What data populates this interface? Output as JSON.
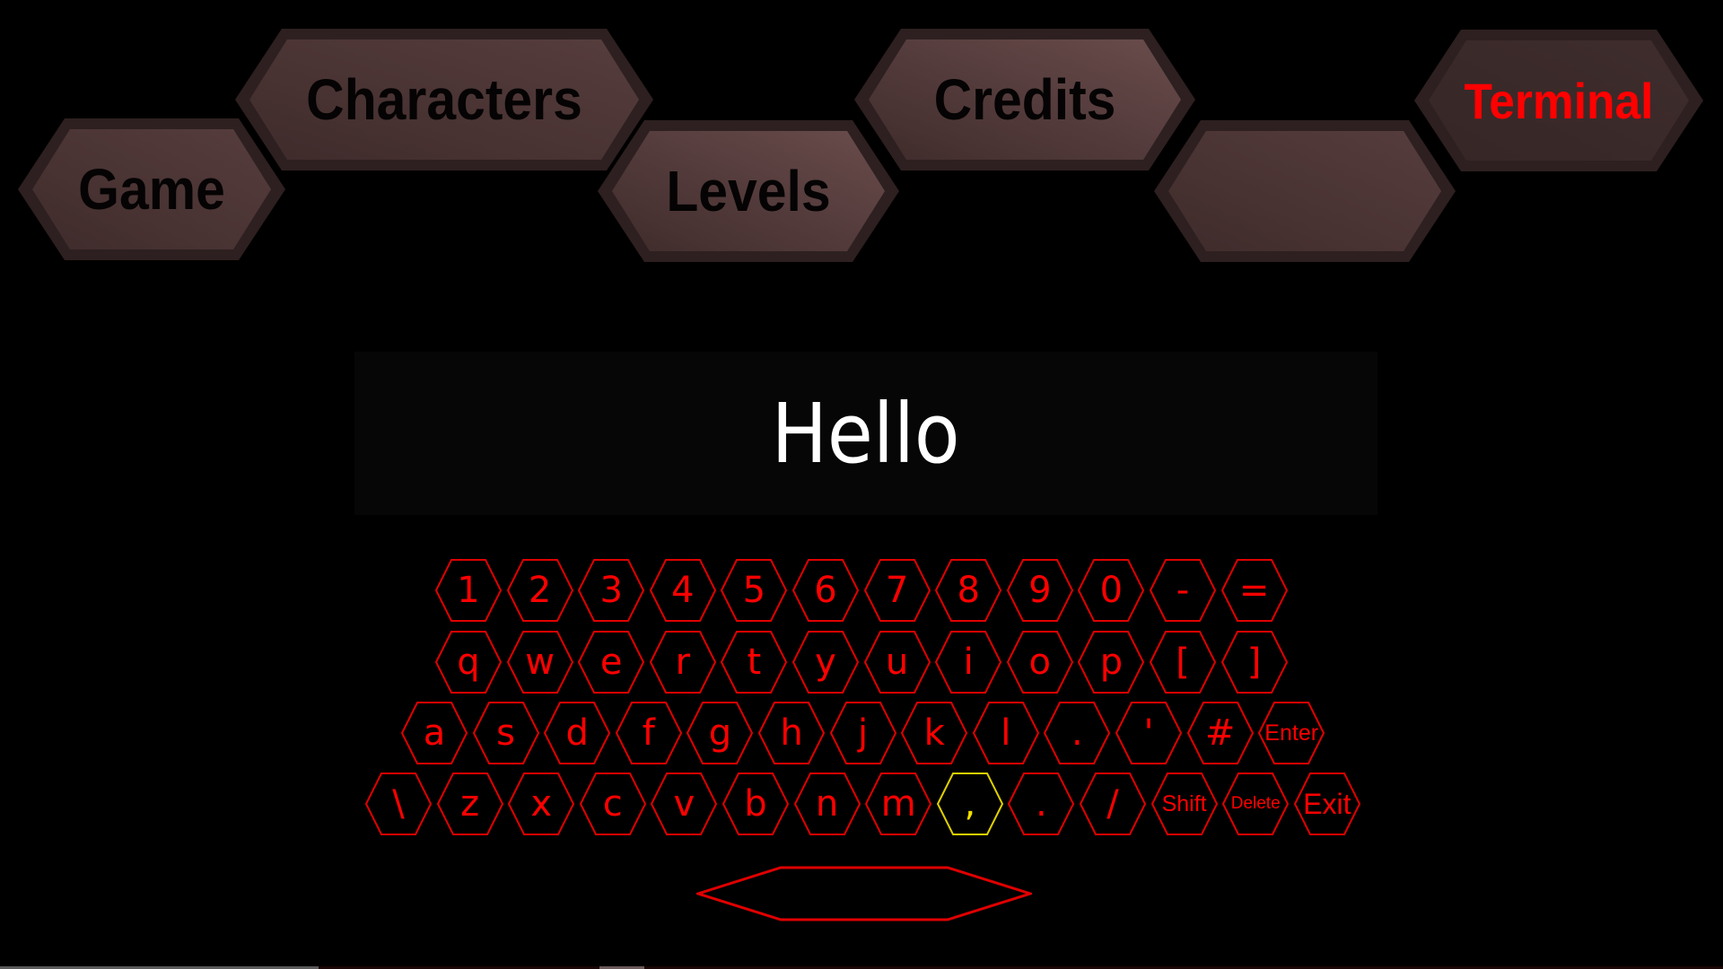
{
  "menu": {
    "items": [
      {
        "id": "game",
        "label": "Game",
        "active": false
      },
      {
        "id": "characters",
        "label": "Characters",
        "active": false
      },
      {
        "id": "levels",
        "label": "Levels",
        "active": false
      },
      {
        "id": "credits",
        "label": "Credits",
        "active": false
      },
      {
        "id": "blank",
        "label": "",
        "active": false
      },
      {
        "id": "terminal",
        "label": "Terminal",
        "active": true
      }
    ]
  },
  "terminal": {
    "text": "Hello"
  },
  "keyboard": {
    "rows": [
      [
        "1",
        "2",
        "3",
        "4",
        "5",
        "6",
        "7",
        "8",
        "9",
        "0",
        "-",
        "="
      ],
      [
        "q",
        "w",
        "e",
        "r",
        "t",
        "y",
        "u",
        "i",
        "o",
        "p",
        "[",
        "]"
      ],
      [
        "a",
        "s",
        "d",
        "f",
        "g",
        "h",
        "j",
        "k",
        "l",
        ".",
        "'",
        "#",
        "Enter"
      ],
      [
        "\\",
        "z",
        "x",
        "c",
        "v",
        "b",
        "n",
        "m",
        ",",
        ".",
        "/",
        "Shift",
        "Delete",
        "Exit"
      ]
    ],
    "selected_key": ",",
    "space_label": ""
  },
  "colors": {
    "key_outline": "#e00000",
    "key_text": "#ff0000",
    "selected_outline": "#e0d000",
    "menu_fill": "#4a3434",
    "menu_border": "#2e2020",
    "active_text": "#ff0000",
    "terminal_text": "#ffffff"
  }
}
